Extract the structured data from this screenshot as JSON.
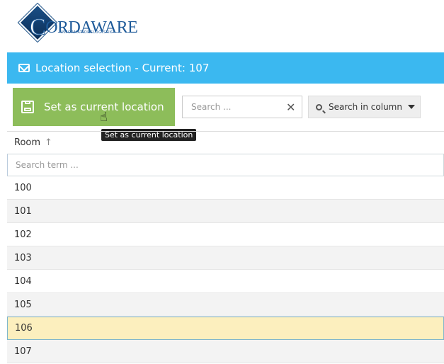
{
  "logo": {
    "word_big": "C",
    "word_rest": "ORDAWARE",
    "sub": "INFORMATIONSLOGISTIK"
  },
  "title": {
    "text": "Location selection - Current: 107",
    "icon": "envelope-icon"
  },
  "toolbar": {
    "set_label": "Set as current location",
    "set_icon": "floppy-disk-icon",
    "tooltip": "Set as current location",
    "search_placeholder": "Search ...",
    "search_clear": "✕",
    "col_search_label": "Search in column"
  },
  "grid": {
    "column_header": "Room",
    "sort_indicator": "↑",
    "filter_placeholder": "Search term ...",
    "rows": [
      "100",
      "101",
      "102",
      "103",
      "104",
      "105",
      "106",
      "107"
    ],
    "selected_row": "106"
  },
  "colors": {
    "titlebar": "#3bb8f0",
    "set_button": "#8dbd5a",
    "selected_row": "#fcefbe"
  }
}
